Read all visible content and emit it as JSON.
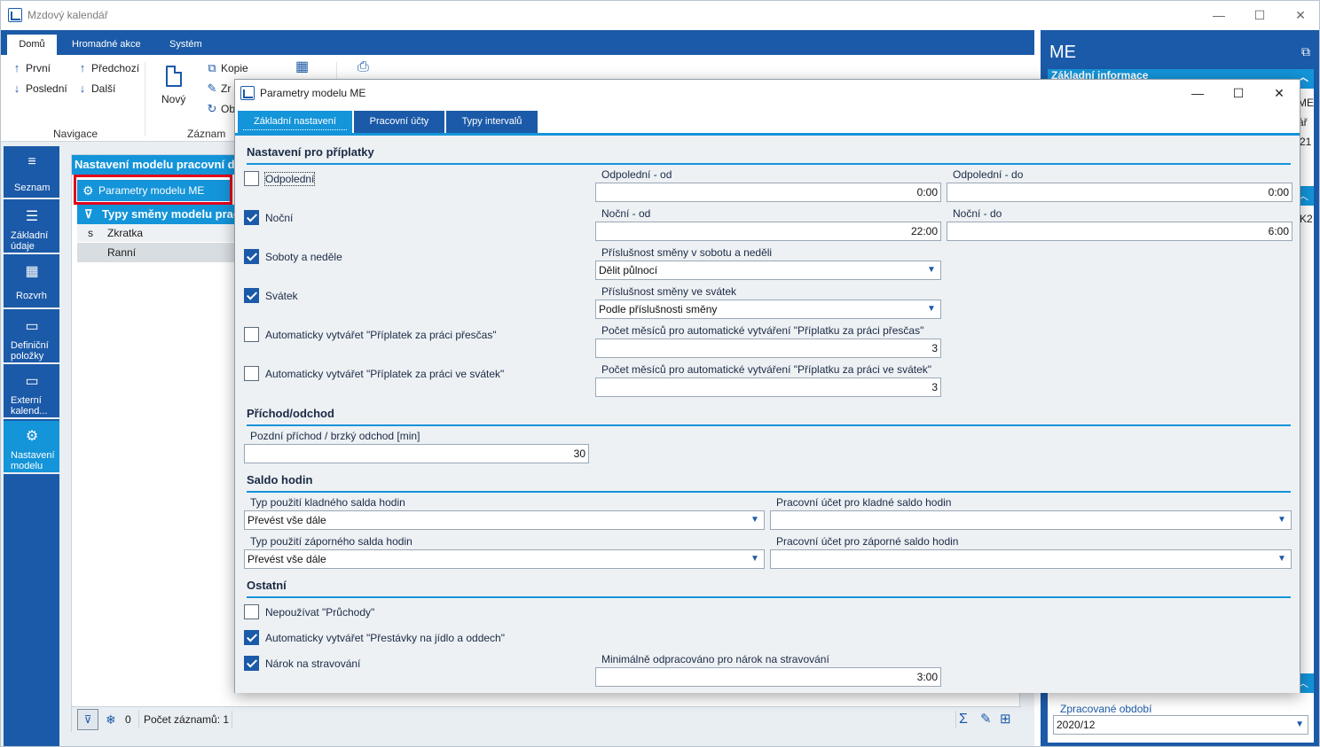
{
  "window": {
    "title": "Mzdový kalendář",
    "minimize": "—",
    "maximize": "☐",
    "close": "✕"
  },
  "ribbon": {
    "tabs": [
      "Domů",
      "Hromadné akce",
      "Systém"
    ],
    "nav": {
      "first": "První",
      "last": "Poslední",
      "prev": "Předchozí",
      "next": "Další",
      "group": "Navigace"
    },
    "record": {
      "new": "Nový",
      "copy": "Kopie",
      "change": "Zr",
      "other": "Ob",
      "group": "Záznam"
    }
  },
  "sidenav": [
    {
      "label": "Seznam",
      "icon": "≡"
    },
    {
      "label": "Základní údaje",
      "icon": "☰"
    },
    {
      "label": "Rozvrh",
      "icon": "▦"
    },
    {
      "label": "Definiční položky",
      "icon": "▭"
    },
    {
      "label": "Externí kalend...",
      "icon": "▭"
    },
    {
      "label": "Nastavení modelu",
      "icon": "⚙"
    }
  ],
  "panel": {
    "header": "Nastavení modelu pracovní d",
    "selected": "Parametry modelu ME",
    "subheader": "Typy směny modelu prac",
    "columns": [
      "s",
      "Zkratka"
    ],
    "rows": [
      {
        "s": "",
        "zkratka": "Ranní"
      }
    ],
    "footer": {
      "zero": "0",
      "count": "Počet záznamů: 1"
    }
  },
  "right_panel": {
    "title": "ME",
    "band": "Základní informace",
    "text1": "ME",
    "text2": "ář",
    "text3": "21",
    "text4": "K2",
    "period_label": "Zpracované období",
    "period_value": "2020/12"
  },
  "dialog": {
    "title": "Parametry modelu ME",
    "tabs": [
      "Základní nastavení",
      "Pracovní účty",
      "Typy intervalů"
    ],
    "sections": {
      "priplatky": "Nastavení pro příplatky",
      "prichod": "Příchod/odchod",
      "saldo": "Saldo hodin",
      "ostatni": "Ostatní"
    },
    "checkboxes": [
      {
        "label": "Odpolední",
        "checked": false
      },
      {
        "label": "Noční",
        "checked": true
      },
      {
        "label": "Soboty a neděle",
        "checked": true
      },
      {
        "label": "Svátek",
        "checked": true
      },
      {
        "label": "Automaticky vytvářet \"Příplatek za práci přesčas\"",
        "checked": false
      },
      {
        "label": "Automaticky vytvářet \"Příplatek za práci ve svátek\"",
        "checked": false
      },
      {
        "label": "Nepoužívat \"Průchody\"",
        "checked": false
      },
      {
        "label": "Automaticky vytvářet \"Přestávky na jídlo a oddech\"",
        "checked": true
      },
      {
        "label": "Nárok na stravování",
        "checked": true
      }
    ],
    "fields": {
      "odpoledni_od": {
        "label": "Odpolední - od",
        "value": "0:00"
      },
      "odpoledni_do": {
        "label": "Odpolední - do",
        "value": "0:00"
      },
      "nocni_od": {
        "label": "Noční - od",
        "value": "22:00"
      },
      "nocni_do": {
        "label": "Noční - do",
        "value": "6:00"
      },
      "prislusnost_sobota": {
        "label": "Příslušnost směny v sobotu a neděli",
        "value": "Dělit půlnocí"
      },
      "prislusnost_svatek": {
        "label": "Příslušnost směny ve svátek",
        "value": "Podle příslušnosti směny"
      },
      "mesice_prescas": {
        "label": "Počet měsíců pro automatické vytváření \"Příplatku za práci přesčas\"",
        "value": "3"
      },
      "mesice_svatek": {
        "label": "Počet měsíců pro automatické vytváření \"Příplatku za práci ve svátek\"",
        "value": "3"
      },
      "pozdni_prichod": {
        "label": "Pozdní příchod / brzký odchod [min]",
        "value": "30"
      },
      "typ_kladne": {
        "label": "Typ použití kladného salda hodin",
        "value": "Převést vše dále"
      },
      "ucet_kladne": {
        "label": "Pracovní účet pro kladné saldo hodin",
        "value": ""
      },
      "typ_zaporne": {
        "label": "Typ použití záporného salda hodin",
        "value": "Převést vše dále"
      },
      "ucet_zaporne": {
        "label": "Pracovní účet pro záporné saldo hodin",
        "value": ""
      },
      "min_stravovani": {
        "label": "Minimálně odpracováno pro nárok na stravování",
        "value": "3:00"
      }
    }
  }
}
